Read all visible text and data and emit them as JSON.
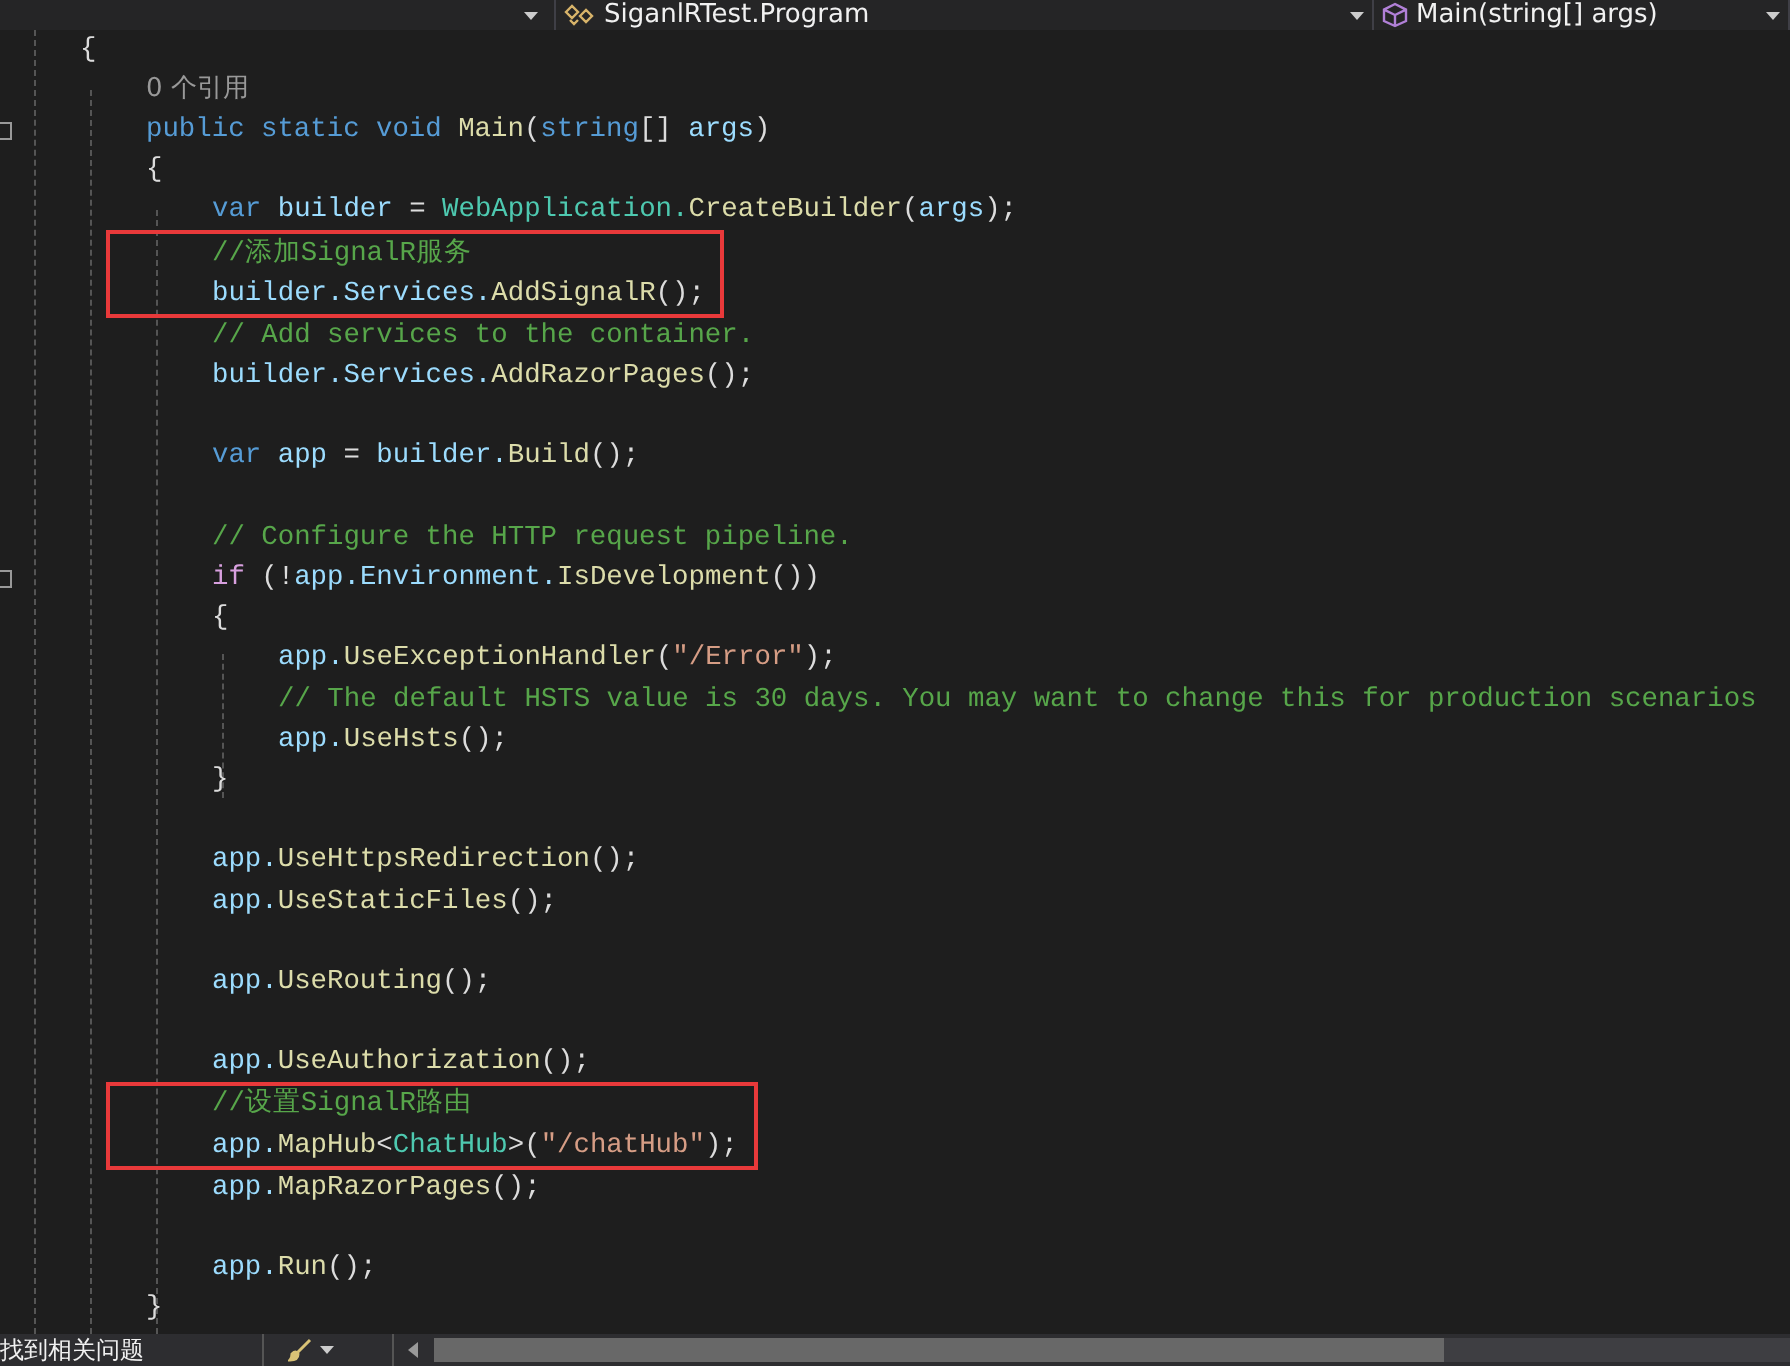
{
  "nav_bar": {
    "dropdowns": [
      {
        "label": "SiganlRTest.Program"
      },
      {
        "label": "Main(string[] args)"
      }
    ]
  },
  "editor": {
    "lines": [
      {
        "fold": false,
        "highlighted": false,
        "tokens": [
          {
            "kind": "plain",
            "text": "{"
          }
        ],
        "children": [
          {
            "fold": false,
            "highlighted": false,
            "tokens": [
              {
                "kind": "lens",
                "text": "0 个引用"
              }
            ]
          },
          {
            "fold": true,
            "highlighted": false,
            "tokens": [
              {
                "kind": "keyword",
                "text": "public static void "
              },
              {
                "kind": "method",
                "text": "Main"
              },
              {
                "kind": "plain",
                "text": "("
              },
              {
                "kind": "keyword",
                "text": "string"
              },
              {
                "kind": "plain",
                "text": "[] "
              },
              {
                "kind": "variable",
                "text": "args"
              },
              {
                "kind": "plain",
                "text": ")"
              }
            ]
          },
          {
            "fold": false,
            "highlighted": false,
            "tokens": [
              {
                "kind": "plain",
                "text": "{"
              }
            ],
            "children": [
              {
                "fold": false,
                "highlighted": false,
                "tokens": [
                  {
                    "kind": "keyword",
                    "text": "var "
                  },
                  {
                    "kind": "variable",
                    "text": "builder"
                  },
                  {
                    "kind": "plain",
                    "text": " = "
                  },
                  {
                    "kind": "type",
                    "text": "WebApplication."
                  },
                  {
                    "kind": "method",
                    "text": "CreateBuilder"
                  },
                  {
                    "kind": "plain",
                    "text": "("
                  },
                  {
                    "kind": "variable",
                    "text": "args"
                  },
                  {
                    "kind": "plain",
                    "text": ");"
                  }
                ]
              },
              {
                "fold": false,
                "highlighted": true,
                "tokens": [
                  {
                    "kind": "comment",
                    "text": "//添加SignalR服务"
                  }
                ]
              },
              {
                "fold": false,
                "highlighted": true,
                "tokens": [
                  {
                    "kind": "variable",
                    "text": "builder.Services."
                  },
                  {
                    "kind": "method",
                    "text": "AddSignalR"
                  },
                  {
                    "kind": "plain",
                    "text": "();"
                  }
                ]
              },
              {
                "fold": false,
                "highlighted": false,
                "tokens": [
                  {
                    "kind": "comment",
                    "text": "// Add services to the container."
                  }
                ]
              },
              {
                "fold": false,
                "highlighted": false,
                "tokens": [
                  {
                    "kind": "variable",
                    "text": "builder.Services."
                  },
                  {
                    "kind": "method",
                    "text": "AddRazorPages"
                  },
                  {
                    "kind": "plain",
                    "text": "();"
                  }
                ]
              },
              {
                "fold": false,
                "highlighted": false
              },
              {
                "fold": false,
                "highlighted": false,
                "tokens": [
                  {
                    "kind": "keyword",
                    "text": "var "
                  },
                  {
                    "kind": "variable",
                    "text": "app"
                  },
                  {
                    "kind": "plain",
                    "text": " = "
                  },
                  {
                    "kind": "variable",
                    "text": "builder."
                  },
                  {
                    "kind": "method",
                    "text": "Build"
                  },
                  {
                    "kind": "plain",
                    "text": "();"
                  }
                ]
              },
              {
                "fold": false,
                "highlighted": false
              },
              {
                "fold": false,
                "highlighted": false,
                "tokens": [
                  {
                    "kind": "comment",
                    "text": "// Configure the HTTP request pipeline."
                  }
                ]
              },
              {
                "fold": true,
                "highlighted": false,
                "tokens": [
                  {
                    "kind": "control",
                    "text": "if"
                  },
                  {
                    "kind": "plain",
                    "text": " (!"
                  },
                  {
                    "kind": "variable",
                    "text": "app.Environment."
                  },
                  {
                    "kind": "method",
                    "text": "IsDevelopment"
                  },
                  {
                    "kind": "plain",
                    "text": "())"
                  }
                ]
              },
              {
                "fold": false,
                "highlighted": false,
                "tokens": [
                  {
                    "kind": "plain",
                    "text": "{"
                  }
                ],
                "children": [
                  {
                    "fold": false,
                    "highlighted": false,
                    "tokens": [
                      {
                        "kind": "variable",
                        "text": "app."
                      },
                      {
                        "kind": "method",
                        "text": "UseExceptionHandler"
                      },
                      {
                        "kind": "plain",
                        "text": "("
                      },
                      {
                        "kind": "string",
                        "text": "\"/Error\""
                      },
                      {
                        "kind": "plain",
                        "text": ");"
                      }
                    ]
                  },
                  {
                    "fold": false,
                    "highlighted": false,
                    "tokens": [
                      {
                        "kind": "comment",
                        "text": "// The default HSTS value is 30 days. You may want to change this for production scenarios"
                      }
                    ]
                  },
                  {
                    "fold": false,
                    "highlighted": false,
                    "tokens": [
                      {
                        "kind": "variable",
                        "text": "app."
                      },
                      {
                        "kind": "method",
                        "text": "UseHsts"
                      },
                      {
                        "kind": "plain",
                        "text": "();"
                      }
                    ]
                  }
                ]
              },
              {
                "fold": false,
                "highlighted": false,
                "tokens": [
                  {
                    "kind": "plain",
                    "text": "}"
                  }
                ]
              },
              {
                "fold": false,
                "highlighted": false
              },
              {
                "fold": false,
                "highlighted": false,
                "tokens": [
                  {
                    "kind": "variable",
                    "text": "app."
                  },
                  {
                    "kind": "method",
                    "text": "UseHttpsRedirection"
                  },
                  {
                    "kind": "plain",
                    "text": "();"
                  }
                ]
              },
              {
                "fold": false,
                "highlighted": false,
                "tokens": [
                  {
                    "kind": "variable",
                    "text": "app."
                  },
                  {
                    "kind": "method",
                    "text": "UseStaticFiles"
                  },
                  {
                    "kind": "plain",
                    "text": "();"
                  }
                ]
              },
              {
                "fold": false,
                "highlighted": false
              },
              {
                "fold": false,
                "highlighted": false,
                "tokens": [
                  {
                    "kind": "variable",
                    "text": "app."
                  },
                  {
                    "kind": "method",
                    "text": "UseRouting"
                  },
                  {
                    "kind": "plain",
                    "text": "();"
                  }
                ]
              },
              {
                "fold": false,
                "highlighted": false
              },
              {
                "fold": false,
                "highlighted": false,
                "tokens": [
                  {
                    "kind": "variable",
                    "text": "app."
                  },
                  {
                    "kind": "method",
                    "text": "UseAuthorization"
                  },
                  {
                    "kind": "plain",
                    "text": "();"
                  }
                ]
              },
              {
                "fold": false,
                "highlighted": true,
                "tokens": [
                  {
                    "kind": "comment",
                    "text": "//设置SignalR路由"
                  }
                ]
              },
              {
                "fold": false,
                "highlighted": true,
                "tokens": [
                  {
                    "kind": "variable",
                    "text": "app."
                  },
                  {
                    "kind": "method",
                    "text": "MapHub"
                  },
                  {
                    "kind": "plain",
                    "text": "<"
                  },
                  {
                    "kind": "type",
                    "text": "ChatHub"
                  },
                  {
                    "kind": "plain",
                    "text": ">("
                  },
                  {
                    "kind": "string",
                    "text": "\"/chatHub\""
                  },
                  {
                    "kind": "plain",
                    "text": ");"
                  }
                ]
              },
              {
                "fold": false,
                "highlighted": false,
                "tokens": [
                  {
                    "kind": "variable",
                    "text": "app."
                  },
                  {
                    "kind": "method",
                    "text": "MapRazorPages"
                  },
                  {
                    "kind": "plain",
                    "text": "();"
                  }
                ]
              },
              {
                "fold": false,
                "highlighted": false
              },
              {
                "fold": false,
                "highlighted": false,
                "tokens": [
                  {
                    "kind": "variable",
                    "text": "app."
                  },
                  {
                    "kind": "method",
                    "text": "Run"
                  },
                  {
                    "kind": "plain",
                    "text": "();"
                  }
                ]
              }
            ]
          },
          {
            "fold": false,
            "highlighted": false,
            "tokens": [
              {
                "kind": "plain",
                "text": "}"
              }
            ]
          }
        ]
      }
    ]
  },
  "status_bar": {
    "message": "找到相关问题"
  }
}
